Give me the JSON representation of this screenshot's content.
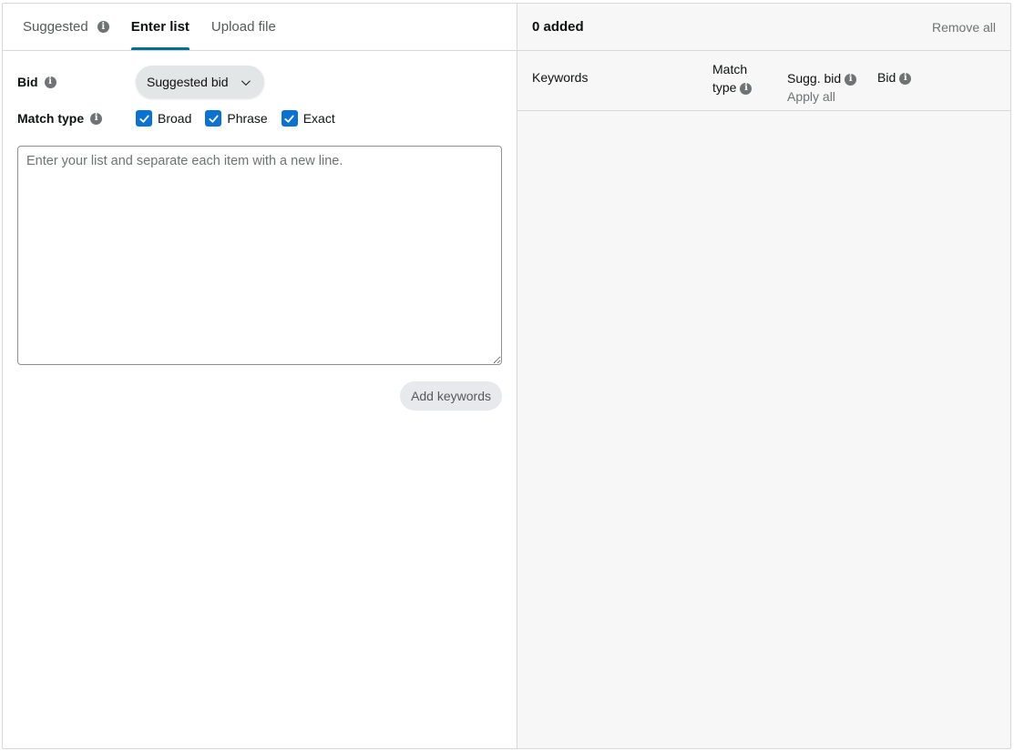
{
  "tabs": [
    {
      "label": "Suggested"
    },
    {
      "label": "Enter list"
    },
    {
      "label": "Upload file"
    }
  ],
  "form": {
    "bid_label": "Bid",
    "bid_dropdown": "Suggested bid",
    "match_type_label": "Match type",
    "match_types": [
      {
        "label": "Broad",
        "checked": true
      },
      {
        "label": "Phrase",
        "checked": true
      },
      {
        "label": "Exact",
        "checked": true
      }
    ],
    "list_value": "",
    "list_placeholder": "Enter your list and separate each item with a new line.",
    "add_button": "Add keywords"
  },
  "added": {
    "count_label": "0 added",
    "remove_all": "Remove all",
    "columns": {
      "keywords": "Keywords",
      "match_line1": "Match",
      "match_line2": "type",
      "sugg_bid": "Sugg. bid",
      "apply_all": "Apply all",
      "bid": "Bid"
    }
  },
  "colors": {
    "accent_tab": "#007185",
    "checkbox": "#0972d3",
    "panel_bg": "#f7f7f7",
    "border": "#d5d9d9"
  },
  "icons": {
    "info": "info-icon",
    "chevron": "chevron-down-icon",
    "check": "checkmark-icon"
  }
}
